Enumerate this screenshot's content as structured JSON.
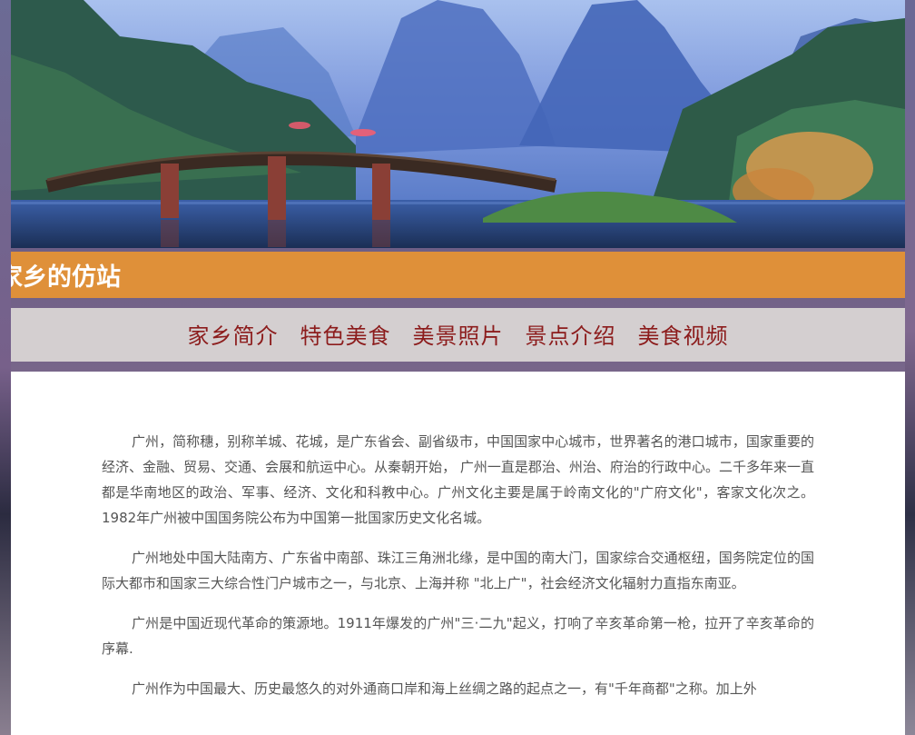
{
  "site": {
    "title": "家乡的仿站"
  },
  "banner": {
    "image": "lakeside-mountain-bridge-landscape"
  },
  "nav": {
    "items": [
      {
        "label": "家乡简介"
      },
      {
        "label": "特色美食"
      },
      {
        "label": "美景照片"
      },
      {
        "label": "景点介绍"
      },
      {
        "label": "美食视频"
      }
    ]
  },
  "content": {
    "paragraphs": [
      "广州，简称穗，别称羊城、花城，是广东省会、副省级市，中国国家中心城市，世界著名的港口城市，国家重要的经济、金融、贸易、交通、会展和航运中心。从秦朝开始， 广州一直是郡治、州治、府治的行政中心。二千多年来一直都是华南地区的政治、军事、经济、文化和科教中心。广州文化主要是属于岭南文化的\"广府文化\"，客家文化次之。 1982年广州被中国国务院公布为中国第一批国家历史文化名城。",
      "广州地处中国大陆南方、广东省中南部、珠江三角洲北缘，是中国的南大门，国家综合交通枢纽，国务院定位的国际大都市和国家三大综合性门户城市之一，与北京、上海并称 \"北上广\"，社会经济文化辐射力直指东南亚。",
      "广州是中国近现代革命的策源地。1911年爆发的广州\"三·二九\"起义，打响了辛亥革命第一枪，拉开了辛亥革命的序幕.",
      "广州作为中国最大、历史最悠久的对外通商口岸和海上丝绸之路的起点之一，有\"千年商都\"之称。加上外"
    ]
  },
  "colors": {
    "title_bar": "#df9039",
    "nav_bg": "#d4cfd0",
    "nav_text": "#8c1c1c",
    "body_text": "#555555"
  }
}
